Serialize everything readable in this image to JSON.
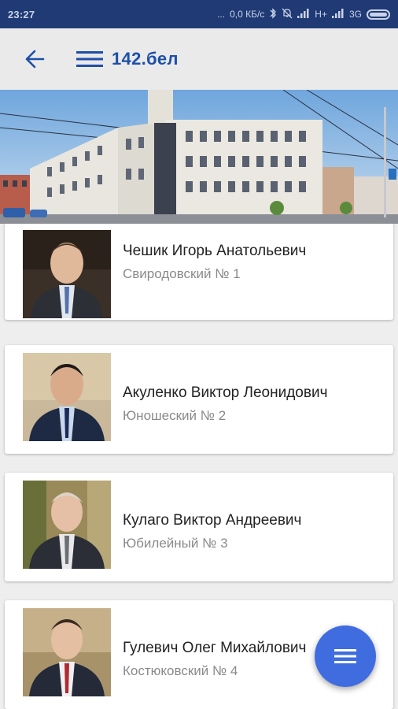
{
  "status_bar": {
    "time": "23:27",
    "dots": "...",
    "speed": "0,0 КБ/с",
    "network1": "H+",
    "network2": "3G"
  },
  "app_bar": {
    "title": "142.бел"
  },
  "colors": {
    "accent": "#1d4fa8",
    "fab": "#3f6de0",
    "status_bar": "#1f3a74"
  },
  "deputies": [
    {
      "name": "Чешик Игорь Анатольевич",
      "district": "Свиродовский № 1"
    },
    {
      "name": "Акуленко Виктор Леонидович",
      "district": "Юношеский № 2"
    },
    {
      "name": "Кулаго Виктор Андреевич",
      "district": "Юбилейный № 3"
    },
    {
      "name": "Гулевич Олег Михайлович",
      "district": "Костюковский № 4"
    }
  ],
  "icons": {
    "back": "arrow-back-icon",
    "menu": "hamburger-menu-icon",
    "fab": "menu-icon"
  }
}
